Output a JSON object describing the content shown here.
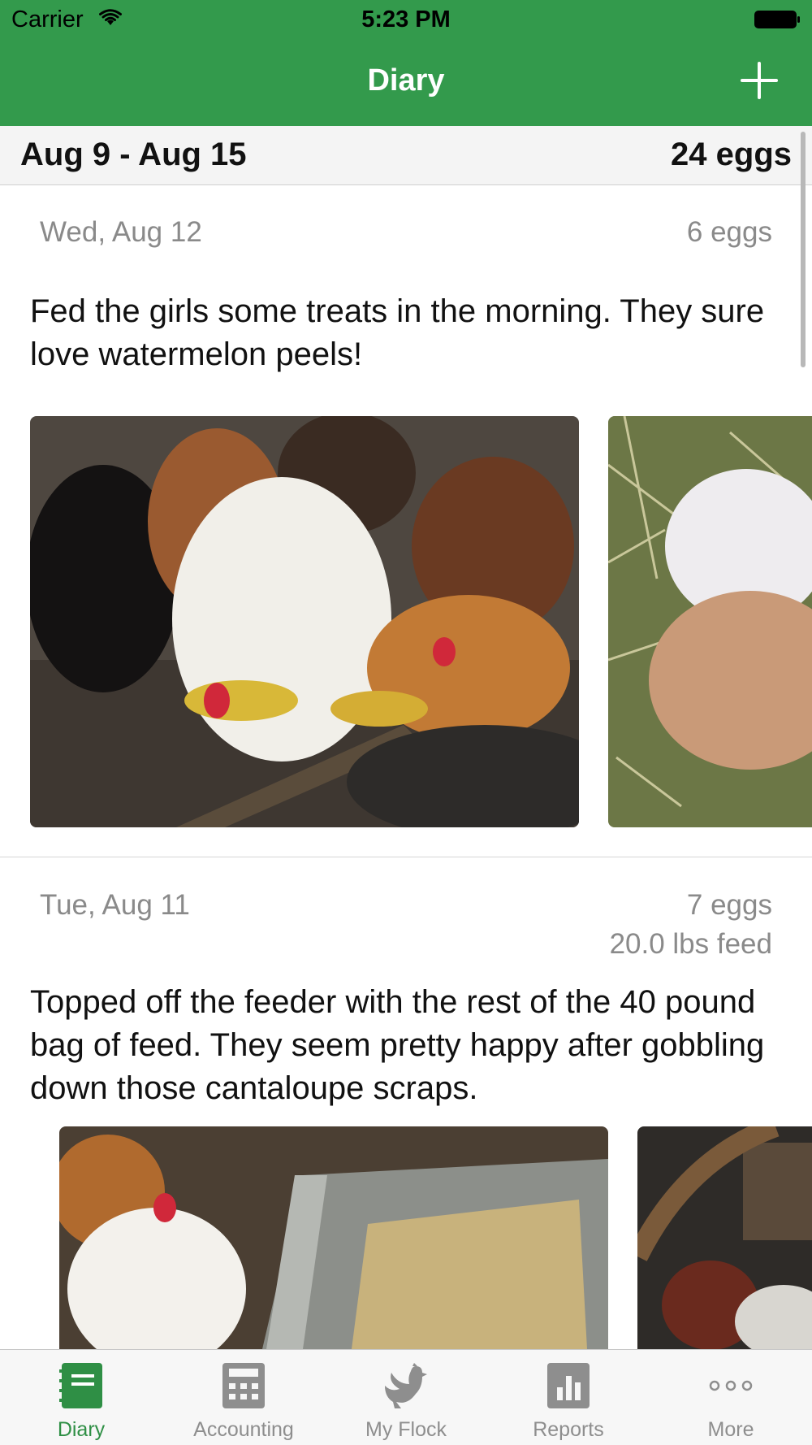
{
  "status_bar": {
    "carrier": "Carrier",
    "time": "5:23 PM"
  },
  "nav": {
    "title": "Diary",
    "add_icon": "plus-icon"
  },
  "week": {
    "range": "Aug 9 - Aug 15",
    "total": "24 eggs"
  },
  "entries": [
    {
      "date": "Wed, Aug 12",
      "eggs": "6 eggs",
      "note": "Fed the girls some treats in the morning. They sure love watermelon peels!",
      "photos": [
        "chickens eating watermelon scraps",
        "eggs in hay"
      ]
    },
    {
      "date": "Tue, Aug 11",
      "eggs": "7 eggs",
      "feed": "20.0 lbs feed",
      "note": "Topped off the feeder with the rest of the 40 pound bag of feed. They seem pretty happy after gobbling down those cantaloupe scraps.",
      "photos": [
        "chickens by metal feeder",
        "chickens in coop"
      ]
    }
  ],
  "tabs": [
    {
      "label": "Diary",
      "icon": "diary-icon",
      "active": true
    },
    {
      "label": "Accounting",
      "icon": "calculator-icon",
      "active": false
    },
    {
      "label": "My Flock",
      "icon": "chicken-icon",
      "active": false
    },
    {
      "label": "Reports",
      "icon": "bar-chart-icon",
      "active": false
    },
    {
      "label": "More",
      "icon": "more-dots-icon",
      "active": false
    }
  ],
  "colors": {
    "accent": "#339a4c",
    "tab_active": "#2f8f45",
    "tab_inactive": "#8e8e8e"
  }
}
